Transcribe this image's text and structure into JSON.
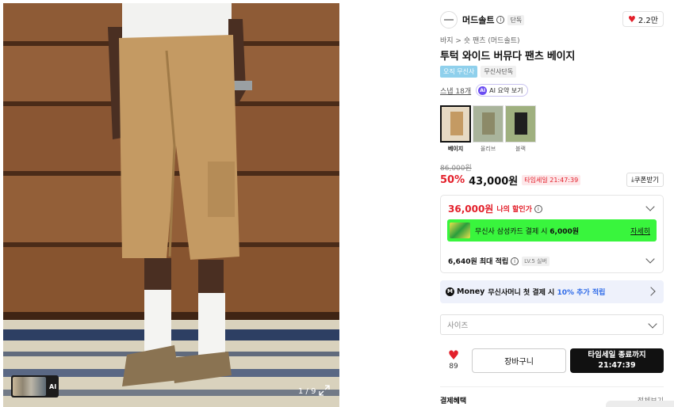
{
  "product_image": {
    "pager": "1 / 9",
    "ai_thumb_label": "AI",
    "colors": {
      "wood": "#8c5a35",
      "shorts": "#c49a63",
      "rug": "#d9d2bd",
      "rug_blue": "#2d3f63"
    }
  },
  "brand": {
    "name": "머드솔트",
    "info_icon": "info-icon",
    "tag": "단독",
    "likes": "2.2만"
  },
  "breadcrumb": "바지 > 숏 팬츠 (머드솔트)",
  "title": "투턱 와이드 버뮤다 팬츠 베이지",
  "badges": [
    "오직 무신사",
    "무신사단독"
  ],
  "reviews": "스냅 18개",
  "ai_summary": {
    "icon_text": "AI",
    "label": "AI 요약 보기"
  },
  "swatches": [
    {
      "label": "베이지",
      "selected": true,
      "color": "#c49a63"
    },
    {
      "label": "올리브",
      "selected": false,
      "color": "#8c8a68"
    },
    {
      "label": "블랙",
      "selected": false,
      "color": "#1f1f1f"
    }
  ],
  "price": {
    "original": "86,000원",
    "discount": "50%",
    "sale": "43,000원",
    "timesale_tag": "타임세일 21:47:39",
    "coupon_button": "쿠폰받기",
    "coupon_prefix": "⤓"
  },
  "benefit": {
    "my_price": "36,000원",
    "my_price_label": "나의 할인가",
    "card_text": "무신사 삼성카드 결제 시",
    "card_amount": "6,000원",
    "card_detail": "자세히",
    "point_text": "6,640원 최대 적립",
    "level_tag": "LV.5 실버"
  },
  "money": {
    "logo": "M",
    "brand": "Money",
    "text": "무신사머니 첫 결제 시",
    "highlight": "10% 추가 적립"
  },
  "size_select": {
    "placeholder": "사이즈"
  },
  "buy": {
    "wish_count": "89",
    "cart_label": "장바구니",
    "buy_line1": "타임세일 종료까지",
    "buy_line2": "21:47:39"
  },
  "payment": {
    "title": "결제혜택",
    "all": "전체보기"
  }
}
